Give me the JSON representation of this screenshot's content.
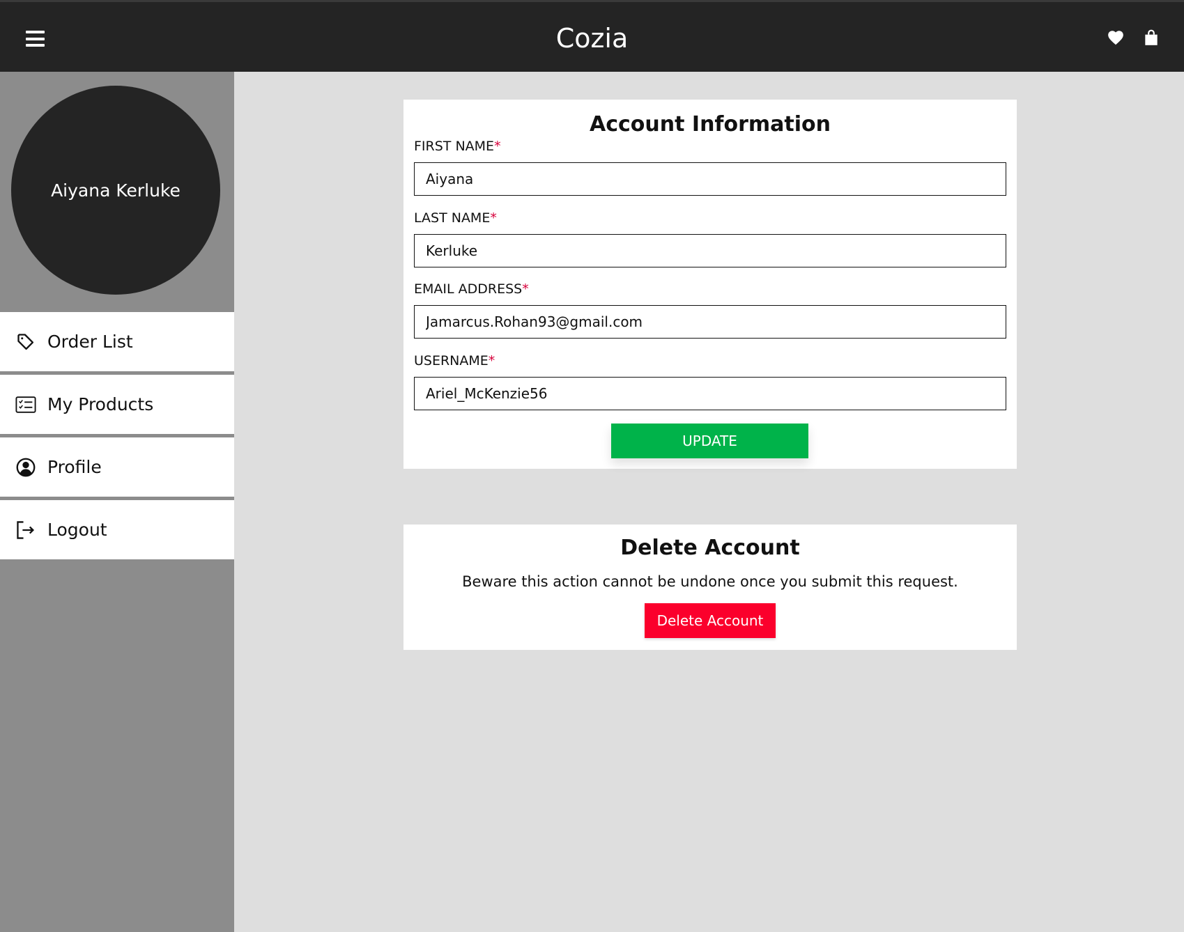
{
  "header": {
    "brand": "Cozia",
    "icons": [
      "hamburger-menu-icon",
      "heart-icon",
      "shopping-bag-icon"
    ]
  },
  "sidebar": {
    "user_name": "Aiyana Kerluke",
    "items": [
      {
        "label": "Order List",
        "icon": "tag-icon"
      },
      {
        "label": "My Products",
        "icon": "checklist-icon"
      },
      {
        "label": "Profile",
        "icon": "user-circle-icon"
      },
      {
        "label": "Logout",
        "icon": "logout-icon"
      }
    ]
  },
  "account_info": {
    "title": "Account Information",
    "required_marker": "*",
    "fields": [
      {
        "label": "FIRST NAME",
        "value": "Aiyana"
      },
      {
        "label": "LAST NAME",
        "value": "Kerluke"
      },
      {
        "label": "EMAIL ADDRESS",
        "value": "Jamarcus.Rohan93@gmail.com"
      },
      {
        "label": "USERNAME",
        "value": "Ariel_McKenzie56"
      }
    ],
    "update_label": "UPDATE"
  },
  "delete_account": {
    "title": "Delete Account",
    "warning": "Beware this action cannot be undone once you submit this request.",
    "button_label": "Delete Account"
  },
  "colors": {
    "header_bg": "#242424",
    "sidebar_bg": "#8c8c8c",
    "page_bg": "#dedede",
    "update_green": "#00b34a",
    "delete_red": "#fb002c",
    "required_red": "#d6003a"
  }
}
